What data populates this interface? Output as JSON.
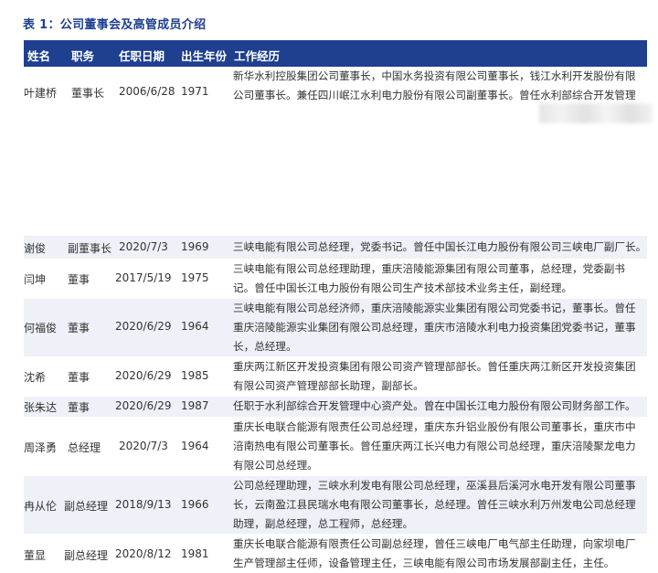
{
  "title": "表 1：公司董事会及高管成员介绍",
  "columns": [
    "姓名",
    "职务",
    "任职日期",
    "出生年份",
    "工作经历"
  ],
  "rows": [
    {
      "name": "叶建桥",
      "position": "董事长",
      "date": "2006/6/28",
      "born": "1971",
      "experience": "新华水利控股集团公司董事长，中国水务投资有限公司董事长，钱江水利开发股份有限公司董事长。兼任四川岷江水利电力股份有限公司副董事长。曾任水利部综合开发管理"
    },
    {
      "name": "谢俊",
      "position": "副董事长",
      "date": "2020/7/3",
      "born": "1969",
      "experience": "三峡电能有限公司总经理，党委书记。曾任中国长江电力股份有限公司三峡电厂副厂长。"
    },
    {
      "name": "闫坤",
      "position": "董事",
      "date": "2017/5/19",
      "born": "1975",
      "experience": "三峡电能有限公司总经理助理，重庆涪陵能源集团有限公司董事，总经理，党委副书记。曾任中国长江电力股份有限公司生产技术部技术业务主任，副经理。"
    },
    {
      "name": "何福俊",
      "position": "董事",
      "date": "2020/6/29",
      "born": "1964",
      "experience": "三峡电能有限公司总经济师，重庆涪陵能源实业集团有限公司党委书记，董事长。曾任重庆涪陵能源实业集团有限公司总经理，重庆市涪陵水利电力投资集团党委书记，董事长，总经理。"
    },
    {
      "name": "沈希",
      "position": "董事",
      "date": "2020/6/29",
      "born": "1985",
      "experience": "重庆两江新区开发投资集团有限公司资产管理部部长。曾任重庆两江新区开发投资集团有限公司资产管理部部长助理，副部长。"
    },
    {
      "name": "张朱达",
      "position": "董事",
      "date": "2020/6/29",
      "born": "1987",
      "experience": "任职于水利部综合开发管理中心资产处。曾在中国长江电力股份有限公司财务部工作。"
    },
    {
      "name": "周泽勇",
      "position": "总经理",
      "date": "2020/7/3",
      "born": "1964",
      "experience": "重庆长电联合能源有限责任公司总经理，重庆东升铝业股份有限公司董事长，重庆市中涪南热电有限公司董事长。曾任重庆两江长兴电力有限公司总经理，重庆涪陵聚龙电力有限公司总经理。"
    },
    {
      "name": "冉从伦",
      "position": "副总经理",
      "date": "2018/9/13",
      "born": "1966",
      "experience": "公司总经理助理，三峡水利发电有限公司总经理，巫溪县后溪河水电开发有限公司董事长，云南盈江县民瑞水电有限公司董事长，总经理。曾任三峡水利万州发电公司总经理助理，副总经理，总工程师，总经理。"
    },
    {
      "name": "董显",
      "position": "副总经理",
      "date": "2020/8/12",
      "born": "1981",
      "experience": "重庆长电联合能源有限责任公司副总经理，曾任三峡电厂电气部主任助理，向家坝电厂生产管理部主任师，设备管理主任，三峡电能有限公司市场发展部副主任，主任。"
    }
  ]
}
